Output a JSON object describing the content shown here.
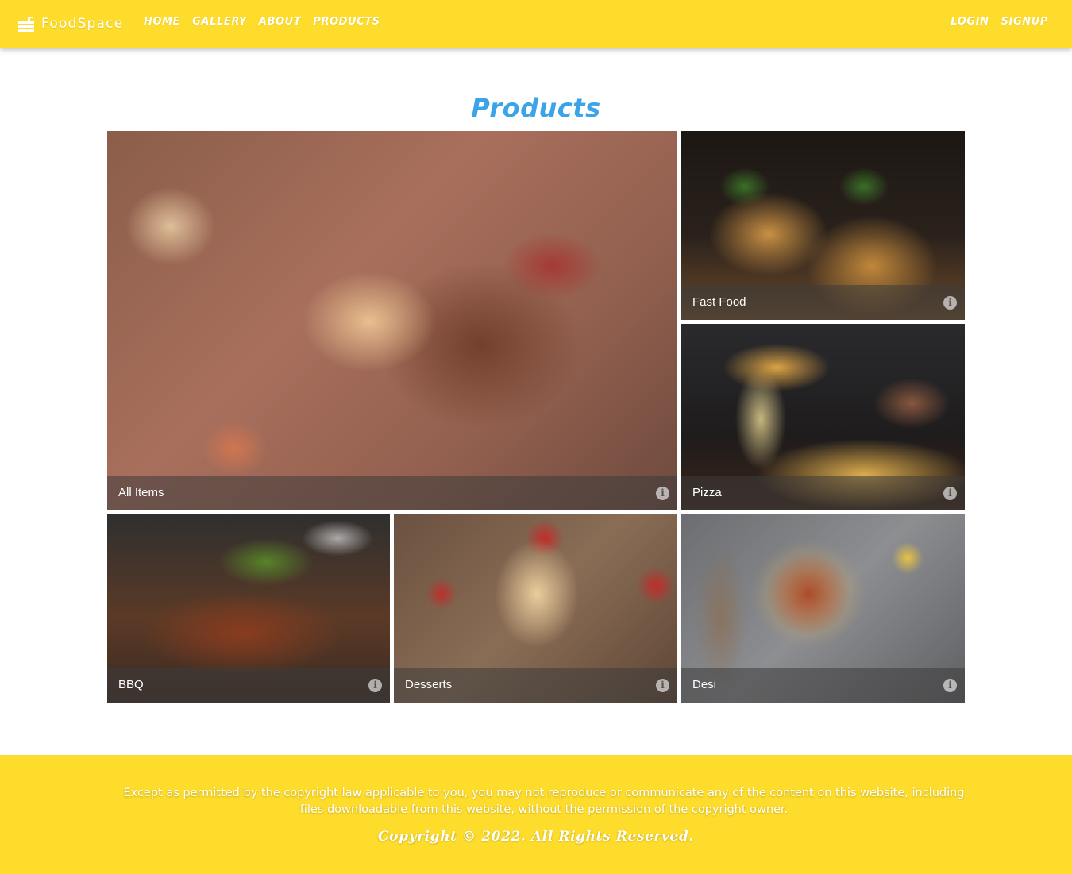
{
  "navbar": {
    "brand": "FoodSpace",
    "links_left": [
      {
        "label": "HOME"
      },
      {
        "label": "GALLERY"
      },
      {
        "label": "ABOUT"
      },
      {
        "label": "PRODUCTS"
      }
    ],
    "links_right": [
      {
        "label": "LOGIN"
      },
      {
        "label": "SIGNUP"
      }
    ]
  },
  "main": {
    "title": "Products",
    "tiles": [
      {
        "label": "All Items"
      },
      {
        "label": "Fast Food"
      },
      {
        "label": "Pizza"
      },
      {
        "label": "BBQ"
      },
      {
        "label": "Desserts"
      },
      {
        "label": "Desi"
      }
    ]
  },
  "footer": {
    "notice": "Except as permitted by the copyright law applicable to you, you may not reproduce or communicate any of the content on this website, including files downloadable from this website, without the permission of the copyright owner.",
    "copyright": "Copyright © 2022. All Rights Reserved."
  },
  "colors": {
    "brand_yellow": "#fedc2b",
    "title_blue": "#3ba4e8"
  }
}
